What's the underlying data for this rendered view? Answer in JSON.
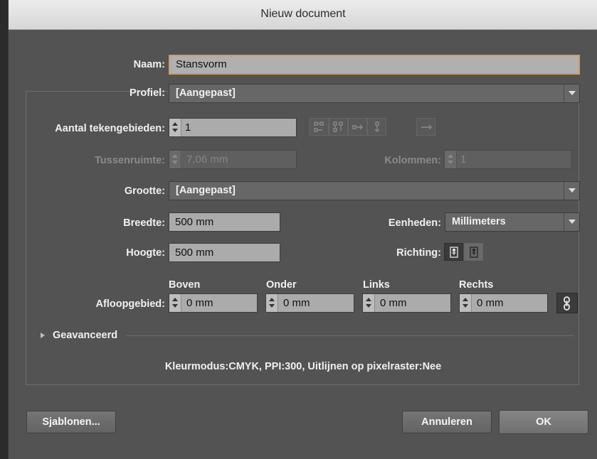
{
  "window": {
    "title": "Nieuw document"
  },
  "name": {
    "label": "Naam:",
    "value": "Stansvorm"
  },
  "profile": {
    "label": "Profiel:",
    "value": "[Aangepast]"
  },
  "artboards": {
    "label": "Aantal tekengebieden:",
    "value": "1"
  },
  "spacing": {
    "label": "Tussenruimte:",
    "value": "7,06 mm"
  },
  "columns": {
    "label": "Kolommen:",
    "value": "1"
  },
  "size": {
    "label": "Grootte:",
    "value": "[Aangepast]"
  },
  "width": {
    "label": "Breedte:",
    "value": "500 mm"
  },
  "height": {
    "label": "Hoogte:",
    "value": "500 mm"
  },
  "units": {
    "label": "Eenheden:",
    "value": "Millimeters"
  },
  "orientation": {
    "label": "Richting:"
  },
  "bleed": {
    "label": "Afloopgebied:",
    "top": {
      "label": "Boven",
      "value": "0 mm"
    },
    "bottom": {
      "label": "Onder",
      "value": "0 mm"
    },
    "left": {
      "label": "Links",
      "value": "0 mm"
    },
    "right": {
      "label": "Rechts",
      "value": "0 mm"
    }
  },
  "advanced": {
    "label": "Geavanceerd"
  },
  "summary": "Kleurmodus:CMYK, PPI:300, Uitlijnen op pixelraster:Nee",
  "buttons": {
    "templates": "Sjablonen...",
    "cancel": "Annuleren",
    "ok": "OK"
  }
}
